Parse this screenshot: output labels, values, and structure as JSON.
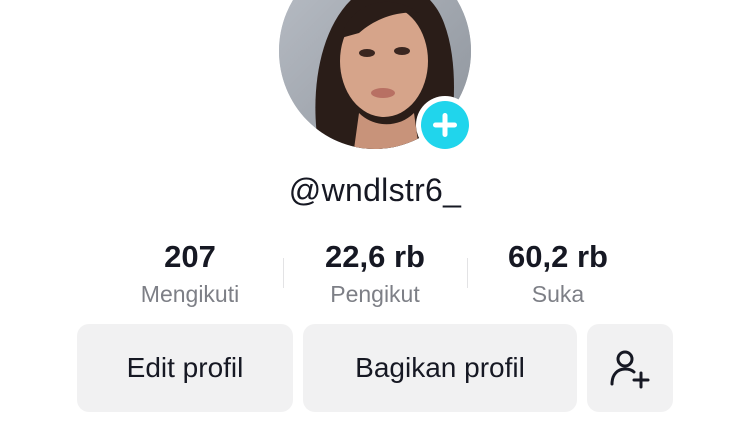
{
  "profile": {
    "username": "@wndlstr6_",
    "avatar_icon": "profile-photo",
    "add_icon": "plus-icon",
    "accent_color": "#20d5ec"
  },
  "stats": [
    {
      "value": "207",
      "label": "Mengikuti"
    },
    {
      "value": "22,6 rb",
      "label": "Pengikut"
    },
    {
      "value": "60,2 rb",
      "label": "Suka"
    }
  ],
  "actions": {
    "edit_label": "Edit profil",
    "share_label": "Bagikan profil",
    "add_friend_icon": "add-user-icon"
  }
}
